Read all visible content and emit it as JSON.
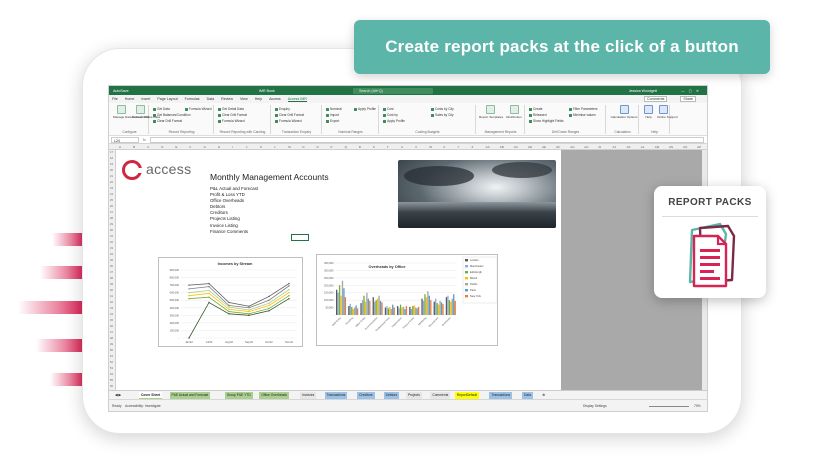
{
  "banner": {
    "text": "Create report packs at the click of a button"
  },
  "report_packs": {
    "title": "REPORT PACKS"
  },
  "colors": {
    "excel_green": "#217346",
    "banner_teal": "#5cb5a9",
    "accent_red": "#d92354"
  },
  "excel": {
    "titlebar": {
      "autosave": "AutoSave",
      "filename": "IMR Book",
      "search": "Search (Alt+Q)",
      "user": "Jessica Woodgett"
    },
    "tabs": [
      "File",
      "Home",
      "Insert",
      "Page Layout",
      "Formulas",
      "Data",
      "Review",
      "View",
      "Help",
      "Access",
      "Access IMR"
    ],
    "active_tab": "Access IMR",
    "tab_actions": {
      "comments": "Comments",
      "share": "Share"
    },
    "ribbon": {
      "groups": [
        {
          "label": "Configure",
          "buttons": [
            "Manage Data Connections",
            "Refresh Offline Data"
          ]
        },
        {
          "label": "Record Reporting",
          "buttons": [
            "Get Data",
            "Get Balances/Condition",
            "Clear Drill Format",
            "Formula Wizard"
          ]
        },
        {
          "label": "Record Reporting with Caching",
          "buttons": [
            "Get Detail Data",
            "Clear Drill Format",
            "Formula Wizard"
          ]
        },
        {
          "label": "Transaction Enquiry",
          "buttons": [
            "Enquiry",
            "Clear Drill Format",
            "Formula Wizard"
          ]
        },
        {
          "label": "Nominal Ranges",
          "buttons": [
            "Nominal",
            "Import",
            "Export",
            "Apply Profile"
          ]
        },
        {
          "label": "Costing Budgets",
          "buttons": [
            "Cost",
            "Cost by",
            "Apply Profile",
            "Costs by City",
            "Sales by City"
          ]
        },
        {
          "label": "Management Reports",
          "buttons": [
            "Report Templates",
            "Distribution"
          ]
        },
        {
          "label": "Drill Down Ranges",
          "buttons": [
            "Create",
            "Released",
            "Show Highlight Fields",
            "Filter Parameters",
            "Minimise values"
          ]
        },
        {
          "label": "Calculation",
          "buttons": [
            "Calculation Options"
          ]
        },
        {
          "label": "Help",
          "buttons": [
            "Help",
            "Online Support"
          ]
        }
      ]
    },
    "formula_bar": {
      "cell_ref": "L24",
      "fx": "fx"
    },
    "columns": [
      "A",
      "B",
      "C",
      "D",
      "E",
      "F",
      "G",
      "H",
      "I",
      "J",
      "K",
      "L",
      "M",
      "N",
      "O",
      "P",
      "Q",
      "R",
      "S",
      "T",
      "U",
      "V",
      "W",
      "X",
      "Y",
      "Z",
      "AA",
      "AB",
      "AC",
      "AD",
      "AE",
      "AF",
      "AG",
      "AH",
      "AI",
      "AJ",
      "AK",
      "AL",
      "AM",
      "AN",
      "AO",
      "AP"
    ],
    "rows": [
      "17",
      "18",
      "19",
      "20",
      "21",
      "22",
      "23",
      "24",
      "25",
      "26",
      "27",
      "28",
      "29",
      "30",
      "31",
      "32",
      "33",
      "34",
      "35",
      "36",
      "37",
      "38",
      "39",
      "40",
      "41",
      "42",
      "43",
      "44",
      "45",
      "46",
      "47",
      "48",
      "49",
      "50",
      "51",
      "52",
      "53",
      "54",
      "55",
      "56"
    ],
    "sheet": {
      "logo": "access",
      "title": "Monthly Management Accounts",
      "contents": [
        "P&L Actual and Forecast",
        "Profit & Loss YTD",
        "Office Overheads",
        "Debtors",
        "Creditors",
        "Projects Listing",
        "Invoice Listing",
        "Finance Comments"
      ]
    },
    "sheet_tabs": [
      {
        "label": "Cover Sheet",
        "color": "#a9d08e",
        "active": true
      },
      {
        "label": "P&E Actual and Forecast",
        "color": "#a9d08e"
      },
      {
        "label": "Group P&E YTD",
        "color": "#a9d08e"
      },
      {
        "label": "Office Overheads",
        "color": "#a9d08e"
      },
      {
        "label": "Invoices",
        "color": "#e7e6e6"
      },
      {
        "label": "Transactions",
        "color": "#9bc2e6"
      },
      {
        "label": "Creditors",
        "color": "#9bc2e6"
      },
      {
        "label": "Debtors",
        "color": "#9bc2e6"
      },
      {
        "label": "Projects",
        "color": "#e7e6e6"
      },
      {
        "label": "Comments",
        "color": "#e7e6e6"
      },
      {
        "label": "ReportDefault",
        "color": "#ffff00"
      },
      {
        "label": "Transactions",
        "color": "#9bc2e6"
      },
      {
        "label": "Data",
        "color": "#9bc2e6"
      }
    ],
    "status": {
      "ready": "Ready",
      "accessibility": "Accessibility: Investigate",
      "display": "Display Settings",
      "zoom": "70%"
    }
  },
  "chart_data": [
    {
      "type": "line",
      "title": "Incomes by Stream",
      "categories": [
        "Jan'22",
        "Jul'22",
        "Aug'22",
        "Sep'22",
        "Oct'22",
        "Nov'22"
      ],
      "yticks": [
        "900,000",
        "800,000",
        "700,000",
        "600,000",
        "500,000",
        "400,000",
        "300,000",
        "200,000",
        "100,000",
        "-"
      ],
      "ylim": [
        0,
        900000
      ],
      "series": [
        {
          "values": [
            700000,
            720000,
            470000,
            420000,
            550000,
            720000
          ],
          "color": "#595959"
        },
        {
          "values": [
            650000,
            680000,
            430000,
            400000,
            500000,
            690000
          ],
          "color": "#7f7f7f"
        },
        {
          "values": [
            600000,
            630000,
            410000,
            370000,
            460000,
            640000
          ],
          "color": "#a9d08e"
        },
        {
          "values": [
            560000,
            590000,
            380000,
            350000,
            430000,
            600000
          ],
          "color": "#ffc000"
        },
        {
          "values": [
            520000,
            540000,
            350000,
            320000,
            390000,
            560000
          ],
          "color": "#70ad47"
        },
        {
          "values": [
            0,
            470000,
            320000,
            300000,
            360000,
            520000
          ],
          "color": "#375623"
        }
      ]
    },
    {
      "type": "bar",
      "title": "Overheads by Office",
      "categories": [
        "Staff Costs",
        "Travelling",
        "Office Costs",
        "Accommodation",
        "Professional Fees",
        "Depreciation",
        "Finance Costs",
        "Marketing",
        "Recruitment",
        "Overheads"
      ],
      "yticks": [
        "350,000",
        "300,000",
        "250,000",
        "200,000",
        "150,000",
        "100,000",
        "50,000",
        "-"
      ],
      "ylim": [
        0,
        350000
      ],
      "series": [
        {
          "name": "London",
          "values": [
            170000,
            60000,
            80000,
            120000,
            50000,
            60000,
            55000,
            110000,
            90000,
            120000
          ],
          "color": "#595959"
        },
        {
          "name": "Manchester",
          "values": [
            150000,
            75000,
            100000,
            90000,
            60000,
            45000,
            40000,
            95000,
            110000,
            130000
          ],
          "color": "#8faadc"
        },
        {
          "name": "Edinburgh",
          "values": [
            200000,
            55000,
            130000,
            100000,
            45000,
            70000,
            60000,
            140000,
            80000,
            100000
          ],
          "color": "#70ad47"
        },
        {
          "name": "Bristol",
          "values": [
            130000,
            40000,
            90000,
            110000,
            55000,
            50000,
            65000,
            120000,
            70000,
            90000
          ],
          "color": "#ffc000"
        },
        {
          "name": "Dublin",
          "values": [
            230000,
            50000,
            150000,
            130000,
            40000,
            55000,
            50000,
            160000,
            95000,
            110000
          ],
          "color": "#a5a5a5"
        },
        {
          "name": "Paris",
          "values": [
            180000,
            65000,
            110000,
            95000,
            70000,
            40000,
            45000,
            130000,
            85000,
            140000
          ],
          "color": "#5b9bd5"
        },
        {
          "name": "New York",
          "values": [
            120000,
            45000,
            95000,
            85000,
            50000,
            60000,
            55000,
            100000,
            75000,
            95000
          ],
          "color": "#ed7d31"
        }
      ]
    }
  ]
}
